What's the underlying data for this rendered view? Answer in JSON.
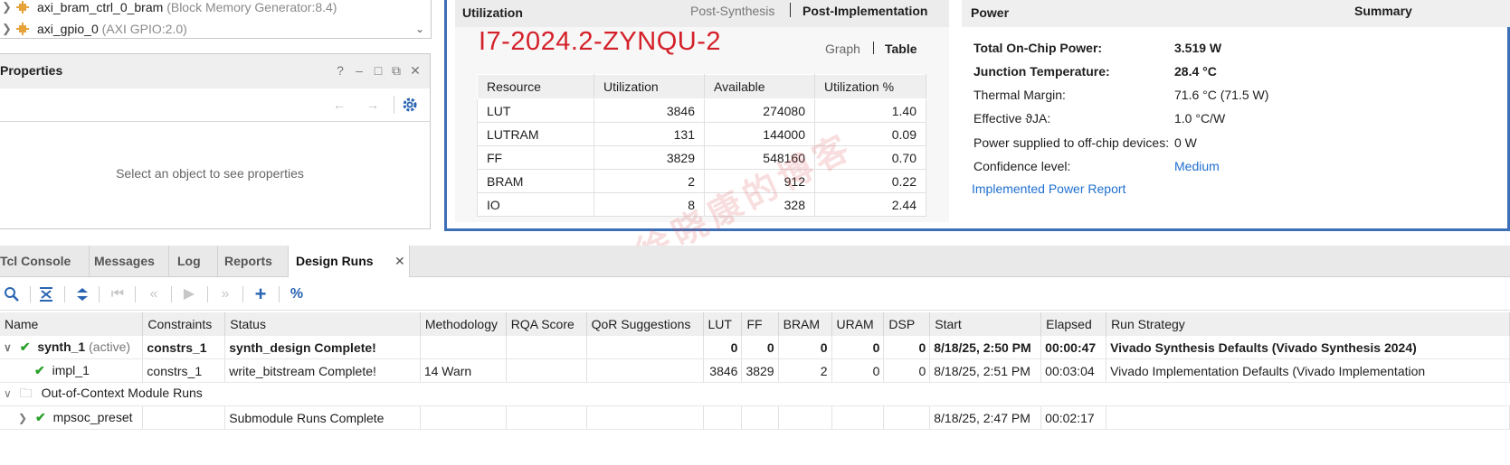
{
  "sources": {
    "rows": [
      {
        "name": "axi_bram_ctrl_0_bram",
        "meta": "(Block Memory Generator:8.4)"
      },
      {
        "name": "axi_gpio_0",
        "meta": "(AXI GPIO:2.0)"
      }
    ]
  },
  "properties": {
    "title": "Properties",
    "help": "?",
    "empty_text": "Select an object to see properties"
  },
  "utilization": {
    "title": "Utilization",
    "tab_post_synthesis": "Post-Synthesis",
    "tab_post_implementation": "Post-Implementation",
    "part": "I7-2024.2-ZYNQU-2",
    "view_graph": "Graph",
    "view_table": "Table",
    "columns": [
      "Resource",
      "Utilization",
      "Available",
      "Utilization %"
    ],
    "rows": [
      [
        "LUT",
        "3846",
        "274080",
        "1.40"
      ],
      [
        "LUTRAM",
        "131",
        "144000",
        "0.09"
      ],
      [
        "FF",
        "3829",
        "548160",
        "0.70"
      ],
      [
        "BRAM",
        "2",
        "912",
        "0.22"
      ],
      [
        "IO",
        "8",
        "328",
        "2.44"
      ]
    ]
  },
  "power": {
    "title": "Power",
    "summary": "Summary",
    "total_label": "Total On-Chip Power:",
    "total_value": "3.519 W",
    "junction_label": "Junction Temperature:",
    "junction_value": "28.4 °C",
    "thermal_label": "Thermal Margin:",
    "thermal_value": "71.6 °C (71.5 W)",
    "theta_label": "Effective ϑJA:",
    "theta_value": "1.0 °C/W",
    "offchip_label": "Power supplied to off-chip devices:",
    "offchip_value": "0 W",
    "confidence_label": "Confidence level:",
    "confidence_value": "Medium",
    "report_link": "Implemented Power Report"
  },
  "bottom_tabs": [
    "Tcl Console",
    "Messages",
    "Log",
    "Reports",
    "Design Runs"
  ],
  "runs": {
    "columns": [
      "Name",
      "Constraints",
      "Status",
      "Methodology",
      "RQA Score",
      "QoR Suggestions",
      "LUT",
      "FF",
      "BRAM",
      "URAM",
      "DSP",
      "Start",
      "Elapsed",
      "Run Strategy"
    ],
    "synth": {
      "name": "synth_1",
      "active": "(active)",
      "constraints": "constrs_1",
      "status": "synth_design Complete!",
      "methodology": "",
      "rqa": "",
      "qor": "",
      "lut": "0",
      "ff": "0",
      "bram": "0",
      "uram": "0",
      "dsp": "0",
      "start": "8/18/25, 2:50 PM",
      "elapsed": "00:00:47",
      "strategy": "Vivado Synthesis Defaults (Vivado Synthesis 2024)"
    },
    "impl": {
      "name": "impl_1",
      "constraints": "constrs_1",
      "status": "write_bitstream Complete!",
      "methodology": "14 Warn",
      "rqa": "",
      "qor": "",
      "lut": "3846",
      "ff": "3829",
      "bram": "2",
      "uram": "0",
      "dsp": "0",
      "start": "8/18/25, 2:51 PM",
      "elapsed": "00:03:04",
      "strategy": "Vivado Implementation Defaults (Vivado Implementation"
    },
    "ooc_group": "Out-of-Context Module Runs",
    "ooc": {
      "name": "mpsoc_preset",
      "status": "Submodule Runs Complete",
      "start": "8/18/25, 2:47 PM",
      "elapsed": "00:02:17"
    }
  },
  "colors": {
    "accent_blue": "#3d6fb6",
    "part_red": "#d4202a",
    "check_green": "#2aa12a",
    "link_blue": "#1f6fd1"
  }
}
